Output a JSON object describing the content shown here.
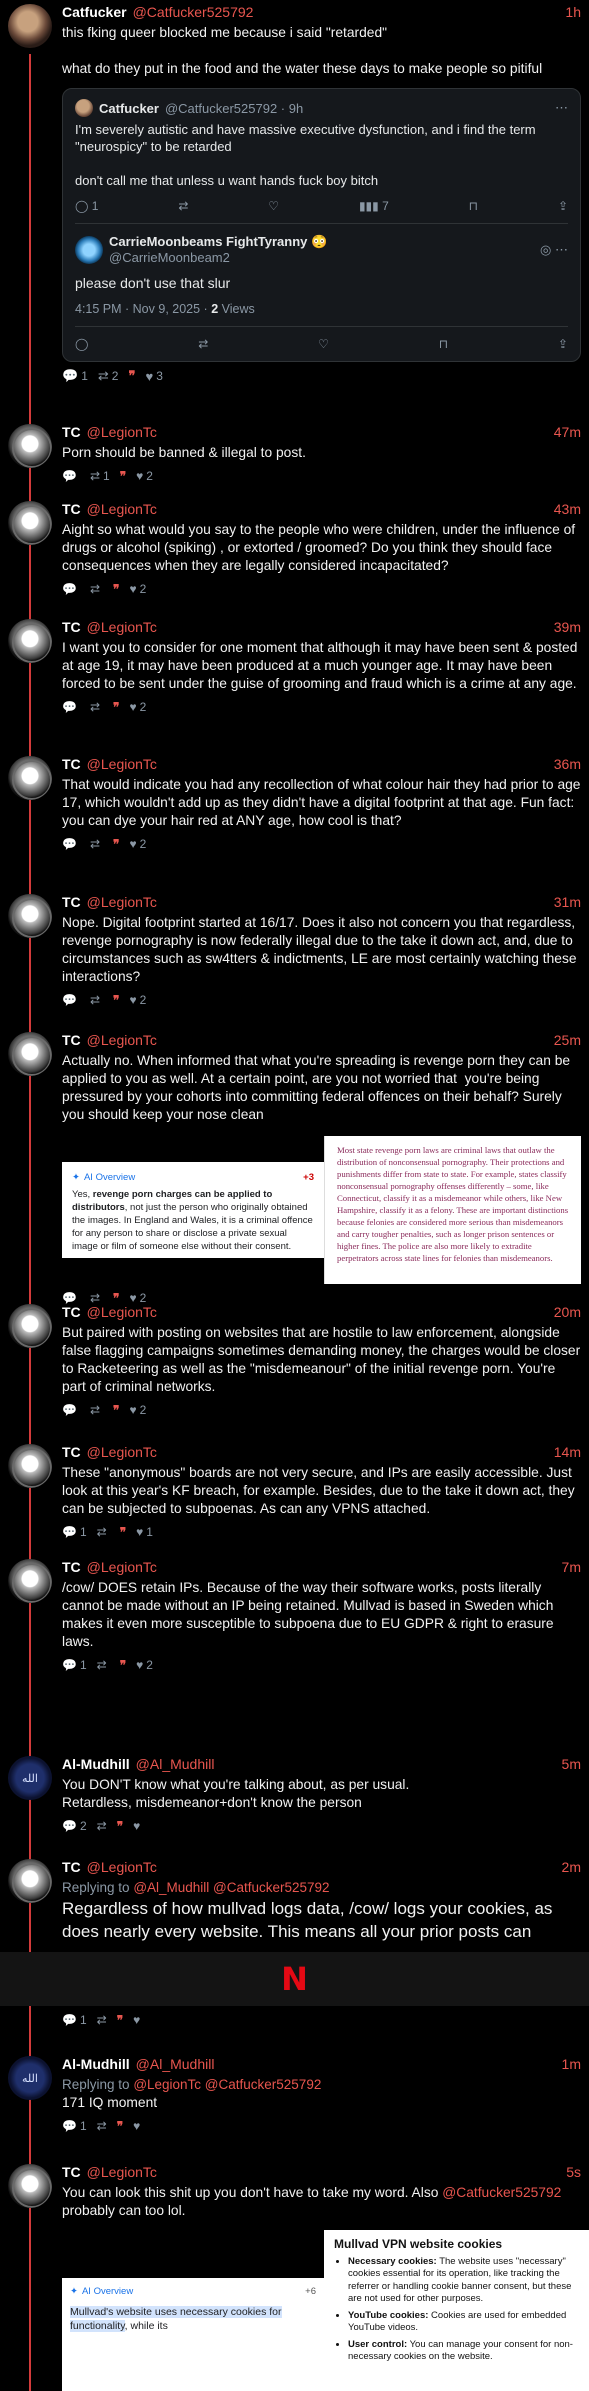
{
  "post_cat": {
    "name": "Catfucker",
    "handle": "@Catfucker525792",
    "time": "1h",
    "text": "this fking queer blocked me because i said \"retarded\"\n\nwhat do they put in the food and the water these days to make people so pitiful",
    "quote": {
      "name": "Catfucker",
      "handle": "@Catfucker525792 · 9h",
      "text": "I'm severely autistic and have massive executive dysfunction, and i find the term \"neurospicy\" to be retarded\n\ndon't call me that unless u want hands fuck boy bitch",
      "views": "7"
    },
    "reply": {
      "name": "CarrieMoonbeams FightTyranny",
      "emoji": "😳",
      "handle": "@CarrieMoonbeam2",
      "text": "please don't use that slur",
      "meta_time": "4:15 PM · Nov 9, 2025 ·",
      "meta_views": "2",
      "meta_views_label": "Views"
    },
    "replies": "1",
    "reposts": "2",
    "likes": "3"
  },
  "tc_posts": [
    {
      "name": "TC",
      "handle": "@LegionTc",
      "time": "47m",
      "text": "Porn should be banned & illegal to post.",
      "replies": "",
      "reposts": "1",
      "likes": "2"
    },
    {
      "name": "TC",
      "handle": "@LegionTc",
      "time": "43m",
      "text": "Aight so what would you say to the people who were children, under the influence of drugs or alcohol (spiking) , or extorted / groomed? Do you think they should face consequences when they are legally considered incapacitated?",
      "replies": "",
      "reposts": "",
      "likes": "2"
    },
    {
      "name": "TC",
      "handle": "@LegionTc",
      "time": "39m",
      "text": "I want you to consider for one moment that although it may have been sent & posted at age 19, it may have been produced at a much younger age. It may have been forced to be sent under the guise of grooming and fraud which is a crime at any age.",
      "replies": "",
      "reposts": "",
      "likes": "2"
    },
    {
      "name": "TC",
      "handle": "@LegionTc",
      "time": "36m",
      "text": "That would indicate you had any recollection of what colour hair they had prior to age 17, which wouldn't add up as they didn't have a digital footprint at that age. Fun fact: you can dye your hair red at ANY age, how cool is that?",
      "replies": "",
      "reposts": "",
      "likes": "2"
    },
    {
      "name": "TC",
      "handle": "@LegionTc",
      "time": "31m",
      "text": "Nope. Digital footprint started at 16/17. Does it also not concern you that regardless, revenge pornography is now federally illegal due to the take it down act, and, due to circumstances such as sw4tters & indictments, LE are most certainly watching these interactions?",
      "replies": "",
      "reposts": "",
      "likes": "2"
    },
    {
      "name": "TC",
      "handle": "@LegionTc",
      "time": "25m",
      "text": "Actually no. When informed that what you're spreading is revenge porn they can be applied to you as well. At a certain point, are you not worried that  you're being pressured by your cohorts into committing federal offences on their behalf? Surely you should keep your nose clean",
      "replies": "",
      "reposts": "",
      "likes": "2"
    },
    {
      "name": "TC",
      "handle": "@LegionTc",
      "time": "20m",
      "text": "But paired with posting on websites that are hostile to law enforcement, alongside false flagging campaigns sometimes demanding money, the charges would be closer to Racketeering as well as the \"misdemeanour\" of the initial revenge porn. You're part of criminal networks.",
      "replies": "",
      "reposts": "",
      "likes": "2"
    },
    {
      "name": "TC",
      "handle": "@LegionTc",
      "time": "14m",
      "text": "These \"anonymous\" boards are not very secure, and IPs are easily accessible. Just look at this year's KF breach, for example. Besides, due to the take it down act, they can be subjected to subpoenas. As can any VPNS attached.",
      "replies": "1",
      "reposts": "",
      "likes": "1"
    },
    {
      "name": "TC",
      "handle": "@LegionTc",
      "time": "7m",
      "text": "/cow/ DOES retain IPs. Because of the way their software works, posts literally cannot be made without an IP being retained. Mullvad is based in Sweden which makes it even more susceptible to subpoena due to EU GDPR & right to erasure laws.",
      "replies": "1",
      "reposts": "",
      "likes": "2"
    }
  ],
  "ai_overview_1": {
    "label": "AI Overview",
    "text_bold": "revenge porn charges can be applied to distributors",
    "text_pre": "Yes, ",
    "text_post": ", not just the person who originally obtained the images. In England and Wales, it is a criminal offence for any person to share or disclose a private sexual image or film of someone else without their consent.",
    "badge": "+3"
  },
  "screenshot_text_1": "Most state revenge porn laws are criminal laws that outlaw the distribution of nonconsensual pornography. Their protections and punishments differ from state to state. For example, states classify nonconsensual pornography offenses differently – some, like Connecticut, classify it as a misdemeanor while others, like New Hampshire, classify it as a felony. These are important distinctions because felonies are considered more serious than misdemeanors and carry tougher penalties, such as longer prison sentences or higher fines. The police are also more likely to extradite perpetrators across state lines for felonies than misdemeanors.",
  "al_post_1": {
    "name": "Al-Mudhill",
    "handle": "@Al_Mudhill",
    "time": "5m",
    "text": "You DON'T know what you're talking about, as per usual.\nRetardless, misdemeanor+don't know the person",
    "replies": "2",
    "reposts": "",
    "likes": ""
  },
  "tc_reply_2m": {
    "name": "TC",
    "handle": "@LegionTc",
    "time": "2m",
    "replying_label": "Replying to",
    "replying_to": "@Al_Mudhill @Catfucker525792",
    "text": "Regardless of how mullvad logs data, /cow/ logs your cookies, as does nearly every website. This means all your prior posts can",
    "replies": "1",
    "reposts": "",
    "likes": ""
  },
  "banner": {
    "logo": "N"
  },
  "al_post_2": {
    "name": "Al-Mudhill",
    "handle": "@Al_Mudhill",
    "time": "1m",
    "replying_label": "Replying to",
    "replying_to": "@LegionTc @Catfucker525792",
    "text": "171 IQ moment",
    "replies": "1",
    "reposts": "",
    "likes": ""
  },
  "tc_final": {
    "name": "TC",
    "handle": "@LegionTc",
    "time": "5s",
    "text_pre": "You can look this shit up you don't have to take my word. Also ",
    "text_mention": "@Catfucker525792",
    "text_post": " probably can too lol."
  },
  "ai_overview_2": {
    "label": "AI Overview",
    "badge": "+6",
    "highlight": "Mullvad's website uses necessary cookies for functionality",
    "tail": ", while its"
  },
  "vpn_card": {
    "title": "Mullvad VPN website cookies",
    "items": [
      {
        "b": "Necessary cookies:",
        "t": " The website uses \"necessary\" cookies essential for its operation, like tracking the referrer or handling cookie banner consent, but these are not used for other purposes."
      },
      {
        "b": "YouTube cookies:",
        "t": " Cookies are used for embedded YouTube videos."
      },
      {
        "b": "User control:",
        "t": " You can manage your consent for non-necessary cookies on the website."
      }
    ]
  },
  "colors": {
    "accent": "#e8564f",
    "thread": "#d33b3b",
    "bg": "#000000"
  },
  "icons": [
    "reply-icon",
    "repost-icon",
    "quote-icon",
    "heart-icon",
    "views-icon",
    "bookmark-icon",
    "share-icon",
    "more-icon",
    "grok-icon"
  ]
}
